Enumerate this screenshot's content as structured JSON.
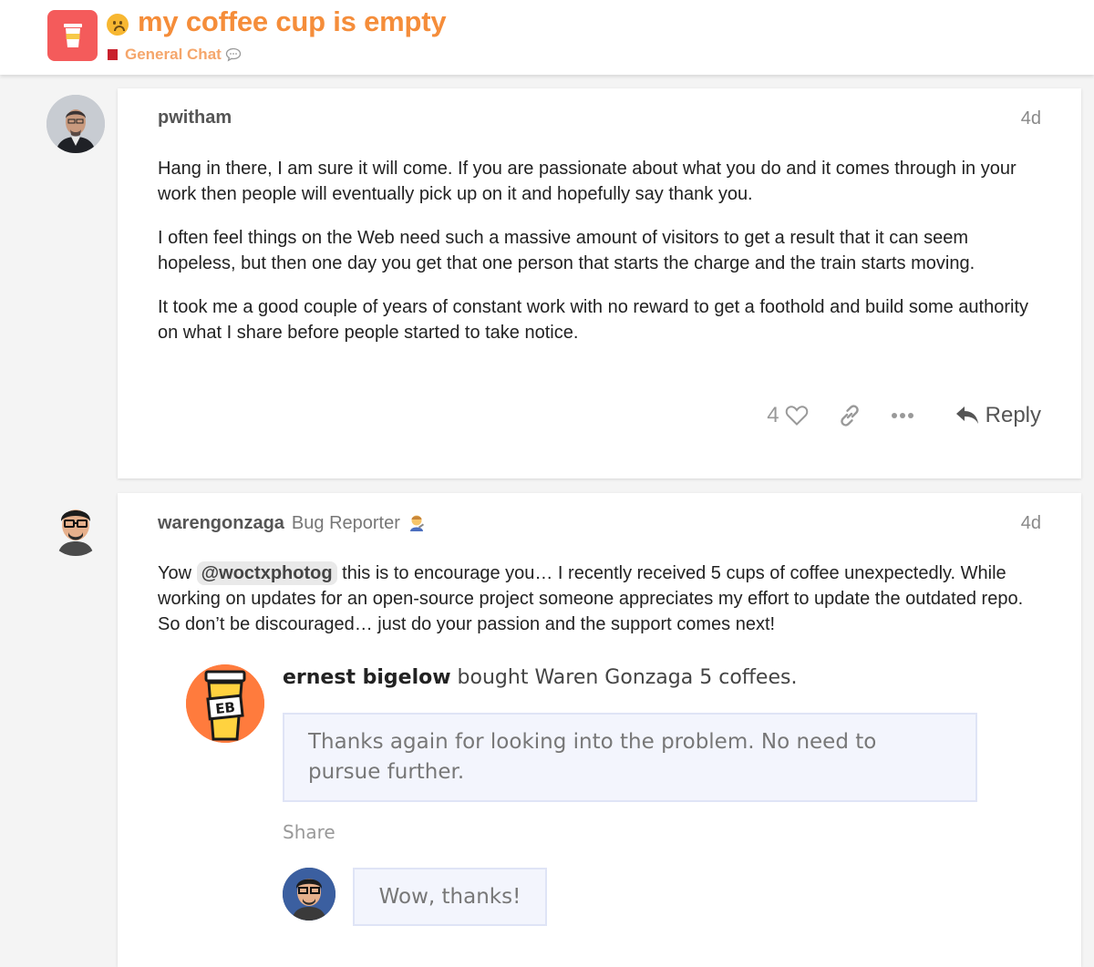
{
  "header": {
    "logo_icon": "coffee-cup-icon",
    "title_emoji_icon": "worried-face-icon",
    "title": "my coffee cup is empty",
    "category": "General Chat",
    "category_color": "#c9202c",
    "title_color": "#f58d3a"
  },
  "posts": [
    {
      "username": "pwitham",
      "date": "4d",
      "paragraphs": [
        "Hang in there, I am sure it will come. If you are passionate about what you do and it comes through in your work then people will eventually pick up on it and hopefully say thank you.",
        "I often feel things on the Web need such a massive amount of visitors to get a result that it can seem hopeless, but then one day you get that one person that starts the charge and the train starts moving.",
        "It took me a good couple of years of constant work with no reward to get a foothold and build some authority on what I share before people started to take notice."
      ],
      "like_count": "4",
      "reply_label": "Reply"
    },
    {
      "username": "warengonzaga",
      "user_title": "Bug Reporter",
      "date": "4d",
      "text_before_mention": "Yow ",
      "mention": "@woctxphotog",
      "text_after_mention": " this is to encourage you… I recently received 5 cups of coffee unexpectedly. While working on updates for an open-source project someone appreciates my effort to update the outdated repo. So don’t be discouraged… just do your passion and the support comes next!",
      "embed": {
        "logo_text": "EB",
        "supporter": "ernest bigelow",
        "action": " bought Waren Gonzaga 5 coffees.",
        "message": "Thanks again for looking into the problem. No need to pursue further.",
        "share": "Share",
        "reply": "Wow, thanks!"
      }
    }
  ]
}
